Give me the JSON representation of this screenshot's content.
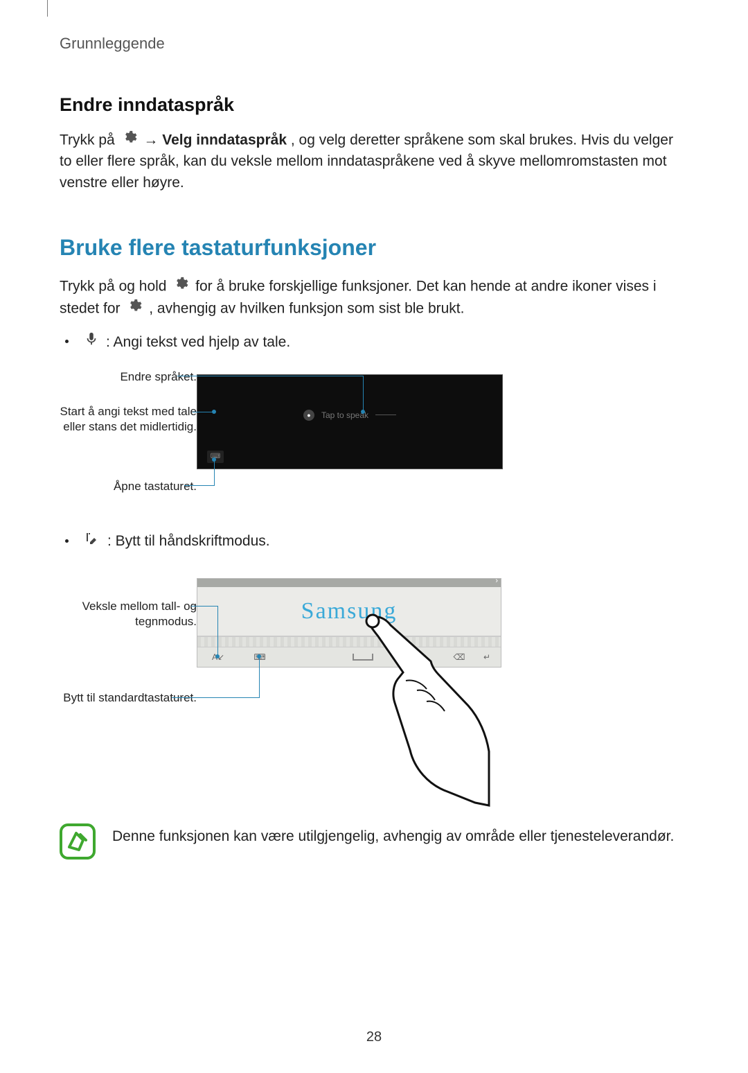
{
  "chapter": "Grunnleggende",
  "section1_title": "Endre inndataspråk",
  "section1_para_a": "Trykk på ",
  "section1_arrow": " → ",
  "section1_bold": "Velg inndataspråk",
  "section1_para_b": ", og velg deretter språkene som skal brukes. Hvis du velger to eller flere språk, kan du veksle mellom inndataspråkene ved å skyve mellomromstasten mot venstre eller høyre.",
  "section2_title": "Bruke flere tastaturfunksjoner",
  "section2_para_a": "Trykk på og hold ",
  "section2_para_b": " for å bruke forskjellige funksjoner. Det kan hende at andre ikoner vises i stedet for ",
  "section2_para_c": ", avhengig av hvilken funksjon som sist ble brukt.",
  "bullet1_text": ": Angi tekst ved hjelp av tale.",
  "diagram1": {
    "label_language": "Endre språket.",
    "label_startstop": "Start å angi tekst med tale eller stans det midlertidig.",
    "label_openkbd": "Åpne tastaturet.",
    "tap_to_speak": "Tap to speak"
  },
  "bullet2_text": ": Bytt til håndskriftmodus.",
  "diagram2": {
    "label_toggle": "Veksle mellom tall- og tegnmodus.",
    "label_stdkbd": "Bytt til standardtastaturet.",
    "handwriting": "Samsung"
  },
  "note_text": "Denne funksjonen kan være utilgjengelig, avhengig av område eller tjenesteleverandør.",
  "page_number": "28"
}
